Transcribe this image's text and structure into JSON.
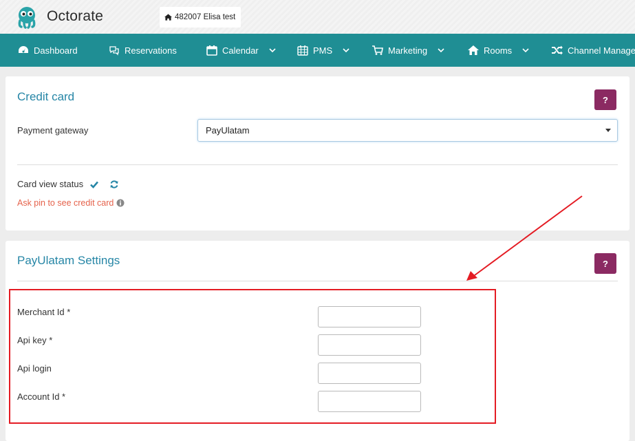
{
  "header": {
    "brand": "Octorate",
    "property_chip": "482007  Elisa test"
  },
  "nav": {
    "items": [
      {
        "label": "Dashboard",
        "icon": "dashboard-icon"
      },
      {
        "label": "Reservations",
        "icon": "chat-icon"
      },
      {
        "label": "Calendar",
        "icon": "calendar-icon",
        "dropdown": true
      },
      {
        "label": "PMS",
        "icon": "calendar-grid-icon",
        "dropdown": true
      },
      {
        "label": "Marketing",
        "icon": "cart-icon",
        "dropdown": true
      },
      {
        "label": "Rooms",
        "icon": "home-icon",
        "dropdown": true
      },
      {
        "label": "Channel Manager",
        "icon": "shuffle-icon"
      }
    ]
  },
  "credit_card": {
    "title": "Credit card",
    "help_label": "?",
    "gateway_label": "Payment gateway",
    "gateway_value": "PayUlatam",
    "card_view_status_label": "Card view status",
    "pin_text": "Ask pin to see credit card"
  },
  "payulatam": {
    "title": "PayUlatam Settings",
    "help_label": "?",
    "fields": [
      {
        "label": "Merchant Id *",
        "value": ""
      },
      {
        "label": "Api key *",
        "value": ""
      },
      {
        "label": "Api login",
        "value": ""
      },
      {
        "label": "Account Id *",
        "value": ""
      }
    ]
  },
  "colors": {
    "nav_bg": "#1f8e94",
    "title_blue": "#2686a6",
    "help_purple": "#8b2a62",
    "pin_red": "#e5624b",
    "annotation_red": "#e41b23"
  }
}
